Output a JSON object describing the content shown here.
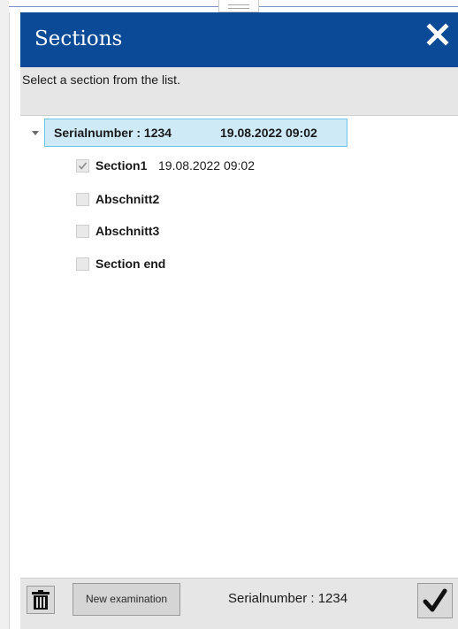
{
  "window": {
    "title": "Sections",
    "close_icon": "close-icon",
    "accent_color": "#0a4a96"
  },
  "instruction": "Select a section from the list.",
  "tree": {
    "root": {
      "serial": "Serialnumber : 1234",
      "date": "19.08.2022 09:02",
      "expanded": true
    },
    "sections": [
      {
        "label": "Section1",
        "date": "19.08.2022 09:02",
        "checked": true
      },
      {
        "label": "Abschnitt2",
        "date": "",
        "checked": false
      },
      {
        "label": "Abschnitt3",
        "date": "",
        "checked": false
      },
      {
        "label": "Section end",
        "date": "",
        "checked": false
      }
    ]
  },
  "footer": {
    "delete_icon": "trash-icon",
    "new_button_label": "New examination",
    "serial": "Serialnumber : 1234",
    "confirm_icon": "checkmark-icon"
  }
}
